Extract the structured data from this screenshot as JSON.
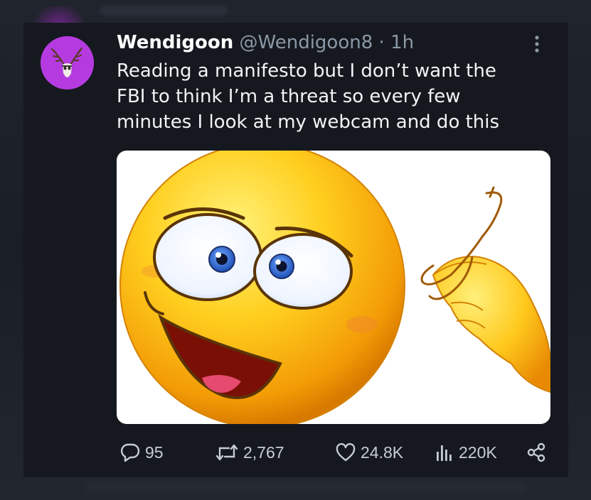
{
  "tweet": {
    "display_name": "Wendigoon",
    "handle": "@Wendigoon8",
    "separator": "·",
    "time": "1h",
    "text": "Reading a manifesto but I don’t want the\nFBI to think I’m a threat so every few\nminutes I look at my webcam and do this"
  },
  "actions": {
    "replies": "95",
    "reposts": "2,767",
    "likes": "24.8K",
    "views": "220K"
  },
  "icons": {
    "more": "more-vertical-icon",
    "reply": "reply-icon",
    "repost": "repost-icon",
    "like": "heart-icon",
    "views": "views-bar-chart-icon",
    "share": "share-icon"
  },
  "colors": {
    "background": "#15191f",
    "text": "#f1f3f5",
    "muted": "#8b98a5",
    "avatar": "#b53be0"
  }
}
